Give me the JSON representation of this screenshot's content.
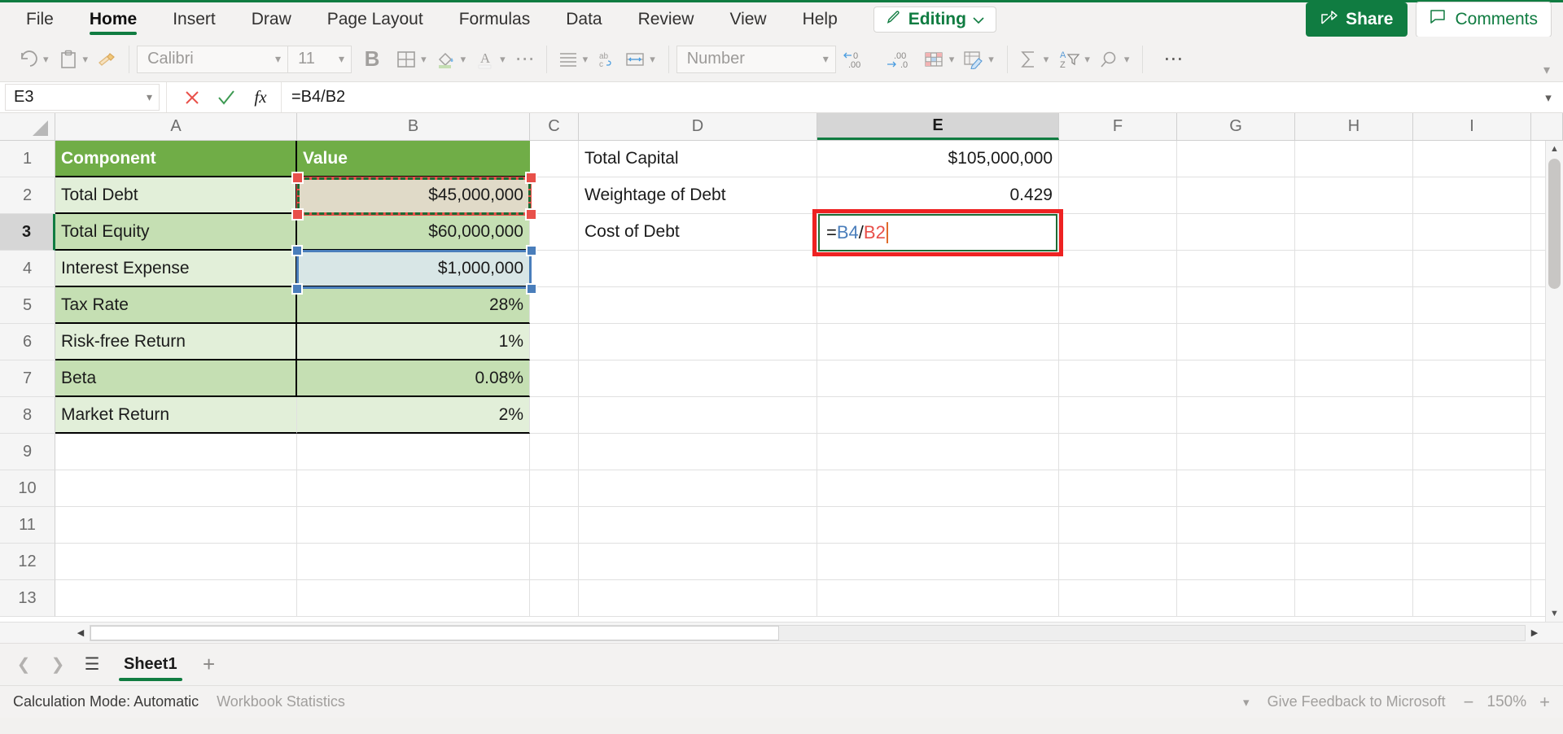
{
  "app": {
    "ribbon_tabs": [
      {
        "label": "File",
        "active": false
      },
      {
        "label": "Home",
        "active": true
      },
      {
        "label": "Insert",
        "active": false
      },
      {
        "label": "Draw",
        "active": false
      },
      {
        "label": "Page Layout",
        "active": false
      },
      {
        "label": "Formulas",
        "active": false
      },
      {
        "label": "Data",
        "active": false
      },
      {
        "label": "Review",
        "active": false
      },
      {
        "label": "View",
        "active": false
      },
      {
        "label": "Help",
        "active": false
      }
    ],
    "editing_button": "Editing",
    "share_button": "Share",
    "comments_button": "Comments",
    "accent_color": "#107c41"
  },
  "toolbar": {
    "font_name": "Calibri",
    "font_size": "11",
    "bold_label": "B",
    "number_format": "Number",
    "icons": [
      "undo-icon",
      "paste-icon",
      "format-painter-icon",
      "borders-icon",
      "fill-color-icon",
      "font-color-icon",
      "more-font-icon",
      "align-icon",
      "wrap-text-icon",
      "merge-cells-icon",
      "decrease-decimal-icon",
      "increase-decimal-icon",
      "conditional-formatting-icon",
      "format-as-table-icon",
      "autosum-icon",
      "sort-filter-icon",
      "find-select-icon",
      "more-options-icon"
    ]
  },
  "formula_bar": {
    "name_box": "E3",
    "cancel_label": "✕",
    "enter_label": "✓",
    "fx_label": "fx",
    "formula": "=B4/B2"
  },
  "grid": {
    "columns": [
      "A",
      "B",
      "C",
      "D",
      "E",
      "F",
      "G",
      "H",
      "I"
    ],
    "selected_column": "E",
    "rows": [
      "1",
      "2",
      "3",
      "4",
      "5",
      "6",
      "7",
      "8",
      "9",
      "10",
      "11",
      "12",
      "13"
    ],
    "selected_row": "3",
    "table": {
      "headers": [
        "Component",
        "Value"
      ],
      "rows": [
        {
          "component": "Total Debt",
          "value": "$45,000,000"
        },
        {
          "component": "Total Equity",
          "value": "$60,000,000"
        },
        {
          "component": "Interest Expense",
          "value": "$1,000,000"
        },
        {
          "component": "Tax Rate",
          "value": "28%"
        },
        {
          "component": "Risk-free Return",
          "value": "1%"
        },
        {
          "component": "Beta",
          "value": "0.08%"
        },
        {
          "component": "Market Return",
          "value": "2%"
        }
      ]
    },
    "side_labels": [
      {
        "label": "Total Capital",
        "value": "$105,000,000"
      },
      {
        "label": "Weightage of Debt",
        "value": "0.429"
      },
      {
        "label": "Cost of Debt",
        "value": ""
      }
    ],
    "editing_cell": {
      "address": "E3",
      "prefix": "=",
      "ref1": "B4",
      "operator": "/",
      "ref2": "B2",
      "ref1_color": "#4a7ebb",
      "ref2_color": "#e8504a"
    },
    "copy_source_cell": "B2",
    "reference_cell": "B4",
    "header_fill": "#70ad47",
    "band_dark": "#c5dfb3",
    "band_light": "#e2efd9"
  },
  "sheet_tabs": {
    "sheets": [
      {
        "name": "Sheet1",
        "active": true
      }
    ],
    "add_label": "+"
  },
  "status_bar": {
    "calculation_mode": "Calculation Mode: Automatic",
    "workbook_statistics": "Workbook Statistics",
    "feedback": "Give Feedback to Microsoft",
    "zoom": "150%",
    "zoom_out": "−",
    "zoom_in": "+"
  }
}
